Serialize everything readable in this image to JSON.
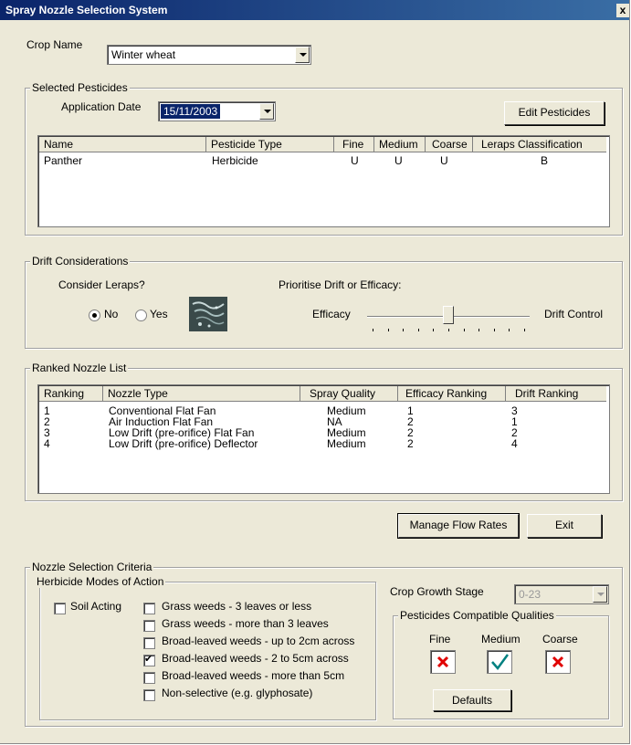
{
  "window": {
    "title": "Spray Nozzle Selection System",
    "close_glyph": "x"
  },
  "crop": {
    "label": "Crop Name",
    "value": "Winter wheat"
  },
  "selected_pesticides": {
    "legend": "Selected Pesticides",
    "date_label": "Application Date",
    "date_value": "15/11/2003",
    "edit_button": "Edit Pesticides",
    "columns": [
      "Name",
      "Pesticide Type",
      "Fine",
      "Medium",
      "Coarse",
      "Leraps Classification"
    ],
    "rows": [
      [
        "Panther",
        "Herbicide",
        "U",
        "U",
        "U",
        "B"
      ]
    ]
  },
  "drift": {
    "legend": "Drift Considerations",
    "leraps_label": "Consider Leraps?",
    "no_label": "No",
    "yes_label": "Yes",
    "selected": "No",
    "priority_label": "Prioritise Drift or Efficacy:",
    "efficacy_label": "Efficacy",
    "drift_label": "Drift Control",
    "slider_position": 0.5,
    "slider_ticks": 11,
    "leraps_icon": "spray-drift-icon"
  },
  "ranked": {
    "legend": "Ranked Nozzle List",
    "columns": [
      "Ranking",
      "Nozzle Type",
      "Spray Quality",
      "Efficacy Ranking",
      "Drift Ranking"
    ],
    "rows": [
      [
        "1",
        "Conventional Flat Fan",
        "Medium",
        "1",
        "3"
      ],
      [
        "2",
        "Air Induction Flat Fan",
        "NA",
        "2",
        "1"
      ],
      [
        "3",
        "Low Drift (pre-orifice) Flat Fan",
        "Medium",
        "2",
        "2"
      ],
      [
        "4",
        "Low Drift (pre-orifice) Deflector",
        "Medium",
        "2",
        "4"
      ]
    ]
  },
  "buttons": {
    "manage": "Manage Flow Rates",
    "exit": "Exit",
    "defaults": "Defaults"
  },
  "criteria": {
    "legend": "Nozzle Selection Criteria",
    "herbicide_legend": "Herbicide Modes of Action",
    "soil_acting": "Soil Acting",
    "modes": [
      {
        "label": "Grass weeds - 3 leaves or less",
        "checked": false
      },
      {
        "label": "Grass weeds - more than 3 leaves",
        "checked": false
      },
      {
        "label": "Broad-leaved weeds - up to 2cm across",
        "checked": false
      },
      {
        "label": "Broad-leaved weeds - 2 to 5cm across",
        "checked": true
      },
      {
        "label": "Broad-leaved weeds - more than 5cm",
        "checked": false
      },
      {
        "label": "Non-selective (e.g. glyphosate)",
        "checked": false
      }
    ],
    "growth_label": "Crop Growth Stage",
    "growth_value": "0-23",
    "compat_legend": "Pesticides Compatible Qualities",
    "qualities": [
      {
        "label": "Fine",
        "state": "cross"
      },
      {
        "label": "Medium",
        "state": "check"
      },
      {
        "label": "Coarse",
        "state": "cross"
      }
    ],
    "colors": {
      "cross": "#e00000",
      "check": "#008080"
    }
  }
}
